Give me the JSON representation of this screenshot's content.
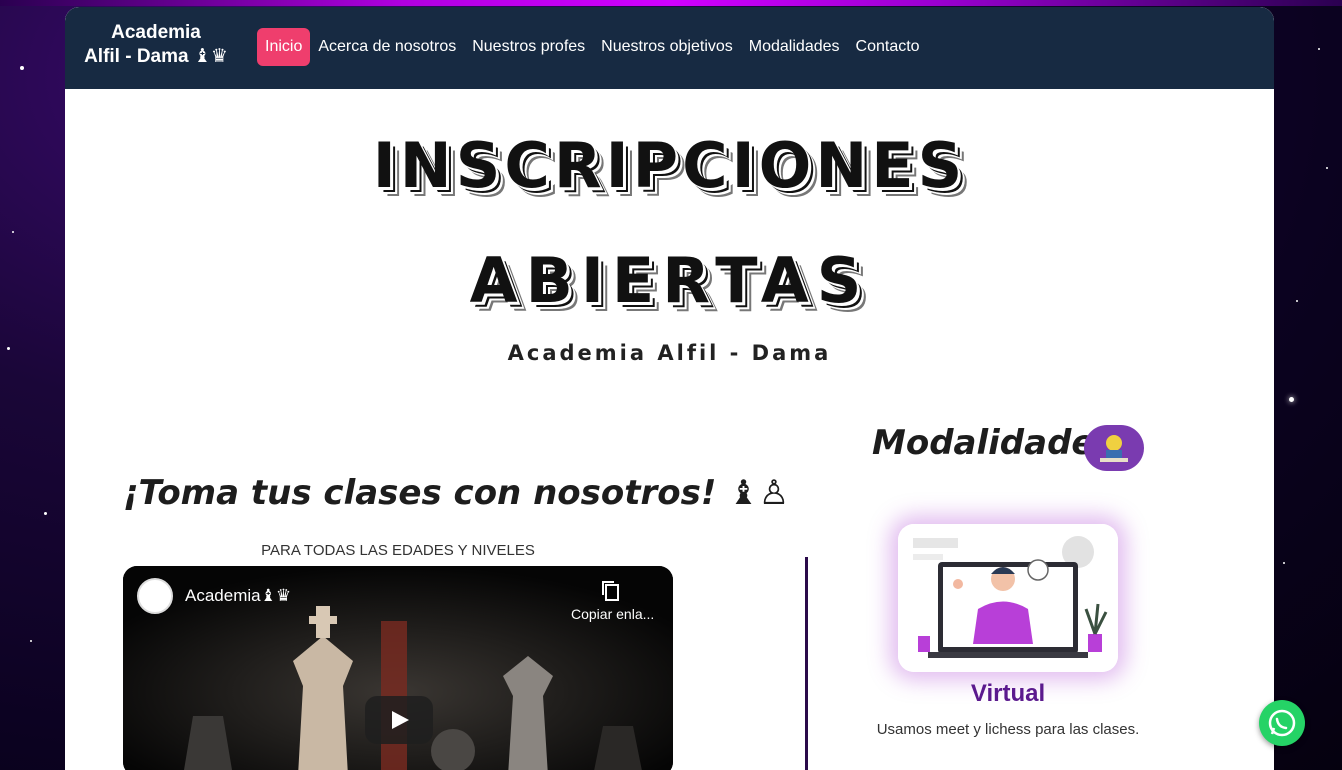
{
  "navbar": {
    "brand_line1": "Academia",
    "brand_line2": "Alfil - Dama ♝♛",
    "items": [
      {
        "label": "Inicio",
        "active": true
      },
      {
        "label": "Acerca de nosotros",
        "active": false
      },
      {
        "label": "Nuestros profes",
        "active": false
      },
      {
        "label": "Nuestros objetivos",
        "active": false
      },
      {
        "label": "Modalidades",
        "active": false
      },
      {
        "label": "Contacto",
        "active": false
      }
    ]
  },
  "hero": {
    "line1": "INSCRIPCIONES",
    "line2": "ABIERTAS",
    "subtitle": "Academia Alfil - Dama"
  },
  "classes": {
    "heading": "¡Toma tus clases con nosotros! ♝♙",
    "subheading": "PARA TODAS LAS EDADES Y NIVELES"
  },
  "video": {
    "channel_title": "Academia♝♛",
    "copy_label": "Copiar enla...",
    "icons": [
      "channel-avatar-icon",
      "copy-link-icon",
      "play-icon"
    ]
  },
  "modalidades": {
    "heading": "Modalidades",
    "card": {
      "title": "Virtual",
      "text": "Usamos meet y lichess para las clases."
    }
  },
  "colors": {
    "navbar_bg": "#172a42",
    "active_nav": "#ef3e6d",
    "accent_purple": "#5b1a8e",
    "whatsapp_green": "#25d366"
  }
}
